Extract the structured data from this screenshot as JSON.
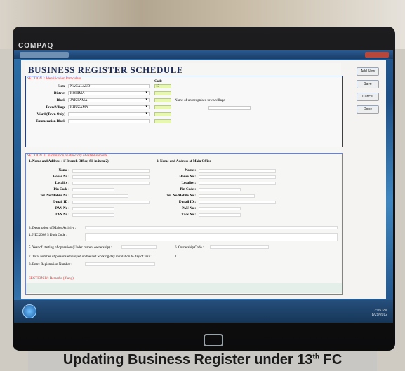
{
  "monitor": {
    "brand": "COMPAQ"
  },
  "form": {
    "title": "BUSINESS REGISTER SCHEDULE",
    "section1": {
      "header": "SECTION I: Identification Particulars",
      "code_header": "Code",
      "fields": [
        {
          "label": "State",
          "value": "NAGALAND",
          "code": "13"
        },
        {
          "label": "District",
          "value": "KOHIMA",
          "code": ""
        },
        {
          "label": "Block",
          "value": "JAKHAMA",
          "code": ""
        },
        {
          "label": "Town/Village",
          "value": "KHUZAMA",
          "code": ""
        },
        {
          "label": "Ward (Town Only)",
          "value": "",
          "code": ""
        },
        {
          "label": "Enumeration Block",
          "value": "",
          "code": ""
        }
      ],
      "unrecognised_label": "Name of unrecognised town/village"
    },
    "section2": {
      "header": "SECTION II: Information on directory of establishments",
      "left_title": "1. Name and Address ( if Branch Office, fill in item 2)",
      "right_title": "2. Name and Address of Main Office",
      "left_fields": [
        "Name :",
        "House No :",
        "Locality :",
        "Pin Code :",
        "Tel. No/Mobile No :",
        "E-mail ID :",
        "PAN No :",
        "TAN No :"
      ],
      "right_fields": [
        "Name :",
        "House No :",
        "Locality :",
        "Pin Code :",
        "Tel. No/Mobile No :",
        "E-mail ID :",
        "PAN No :",
        "TAN No :"
      ],
      "q3": "3. Description of Major Activity :",
      "q4": "4. NIC 2008 5 Digit Code :",
      "q5": "5. Year of starting of operation (Under current ownership) :",
      "q6": "6. Ownership Code :",
      "q7": "7. Total number of persons employed on the last working day in relation to day of visit :",
      "q7_value": "1",
      "q8": "8. Entre Registration Number :"
    },
    "remarks_header": "SECTION IV: Remarks (if any)"
  },
  "buttons": {
    "add_new": "Add New",
    "save": "Save",
    "cancel": "Cancel",
    "done": "Done"
  },
  "taskbar": {
    "time": "3:05 PM",
    "date": "8/29/2012"
  },
  "caption": {
    "main": "Updating Business Register under 13",
    "sup": "th",
    "tail": " FC"
  }
}
